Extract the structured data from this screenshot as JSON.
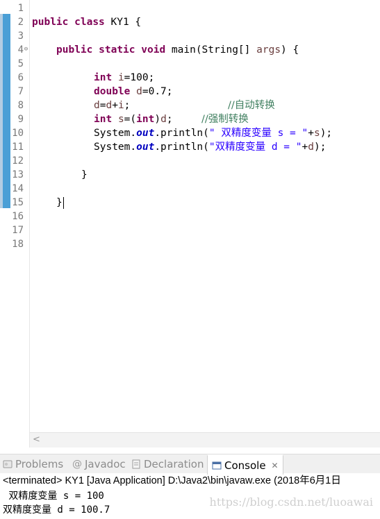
{
  "editor": {
    "line_numbers": [
      "1",
      "2",
      "3",
      "4",
      "5",
      "6",
      "7",
      "8",
      "9",
      "10",
      "11",
      "12",
      "13",
      "14",
      "15",
      "16",
      "17",
      "18"
    ],
    "lines": {
      "l2": {
        "kw1": "public",
        "kw2": "class",
        "rest": "KY1 {"
      },
      "l4": {
        "kw1": "public",
        "kw2": "static",
        "kw3": "void",
        "rest": "main(String[] ",
        "param": "args",
        "tail": ") {"
      },
      "l6": {
        "kw": "int",
        "var": "i",
        "rest": "=100;"
      },
      "l7": {
        "kw": "double",
        "var": "d",
        "rest": "=0.7;"
      },
      "l8": {
        "a": "d",
        "b": "=",
        "c": "d",
        "d": "+",
        "e": "i",
        "f": ";",
        "comment": "//自动转换"
      },
      "l9": {
        "kw": "int",
        "var": "s",
        "b": "=(",
        "kw2": "int",
        "c": ")",
        "d": "d",
        "e": ";",
        "comment": "//强制转换"
      },
      "l10": {
        "pre": "System.",
        "field": "out",
        "mid": ".println(",
        "str": "\" 双精度变量 s = \"",
        "plus": "+",
        "var": "s",
        "tail": ");"
      },
      "l11": {
        "pre": "System.",
        "field": "out",
        "mid": ".println(",
        "str": "\"双精度变量 d = \"",
        "plus": "+",
        "var": "d",
        "tail": ");"
      },
      "l13": {
        "brace": "}"
      },
      "l15": {
        "brace": "}"
      }
    }
  },
  "views": {
    "tabs": [
      {
        "label": "Problems",
        "icon": "problems-icon"
      },
      {
        "label": "Javadoc",
        "icon": "at-icon"
      },
      {
        "label": "Declaration",
        "icon": "declaration-icon"
      },
      {
        "label": "Console",
        "icon": "console-icon",
        "active": true
      }
    ],
    "console_header": "<terminated> KY1 [Java Application] D:\\Java2\\bin\\javaw.exe (2018年6月1日",
    "output": [
      " 双精度变量 s = 100",
      "双精度变量 d = 100.7"
    ],
    "watermark": "https://blog.csdn.net/luoawai"
  }
}
